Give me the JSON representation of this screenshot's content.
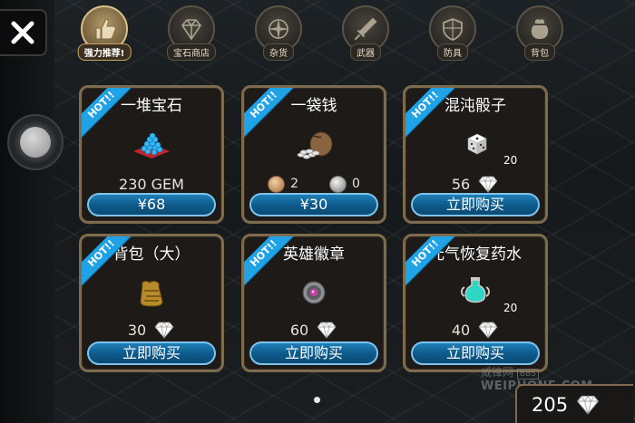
{
  "tabs": [
    {
      "label": "强力推荐!",
      "icon": "thumbs-up-icon",
      "active": true
    },
    {
      "label": "宝石商店",
      "icon": "gem-icon",
      "active": false
    },
    {
      "label": "杂货",
      "icon": "compass-icon",
      "active": false
    },
    {
      "label": "武器",
      "icon": "sword-icon",
      "active": false
    },
    {
      "label": "防具",
      "icon": "shield-icon",
      "active": false
    },
    {
      "label": "背包",
      "icon": "bag-icon",
      "active": false
    }
  ],
  "hot_label": "HOT!!",
  "items": [
    {
      "name": "一堆宝石",
      "price_text": "230 GEM",
      "button": "¥68",
      "icon": "gem-pile-icon"
    },
    {
      "name": "一袋钱",
      "coins": {
        "copper": "2",
        "silver": "0"
      },
      "button": "¥30",
      "icon": "money-bag-icon"
    },
    {
      "name": "混沌骰子",
      "qty": "20",
      "price": "56",
      "button": "立即购买",
      "icon": "dice-icon"
    },
    {
      "name": "背包（大）",
      "price": "30",
      "button": "立即购买",
      "icon": "backpack-icon"
    },
    {
      "name": "英雄徽章",
      "price": "60",
      "button": "立即购买",
      "icon": "badge-icon"
    },
    {
      "name": "元气恢复药水",
      "qty": "20",
      "price": "40",
      "button": "立即购买",
      "icon": "potion-icon"
    }
  ],
  "balance": "205",
  "watermark": {
    "line1": "威锋网",
    "bbs": "BBS",
    "line2": "WEIPHONE.COM"
  },
  "colors": {
    "hot_ribbon": "#1fa2e6",
    "button": "#0e5b8c",
    "card_border": "#7e6a4c"
  }
}
